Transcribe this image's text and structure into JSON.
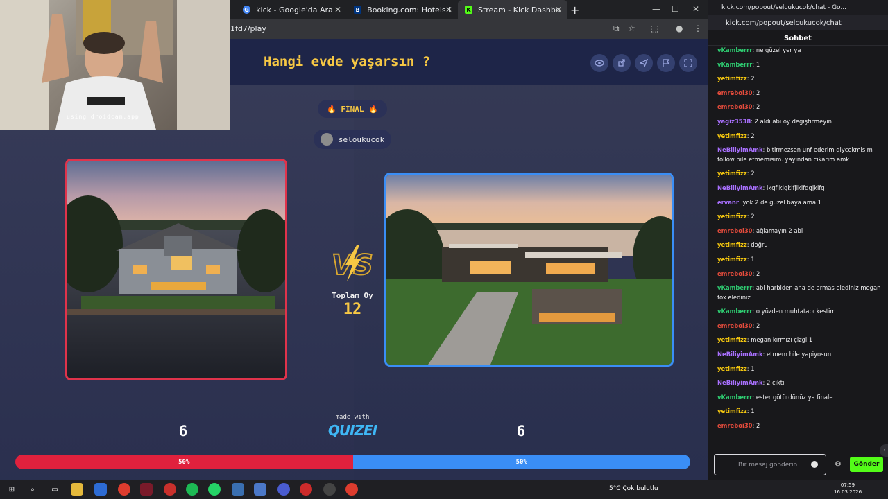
{
  "browser": {
    "tabs": [
      {
        "title": "kick - Google'da Ara",
        "icon": "google-icon",
        "color": "#4285f4"
      },
      {
        "title": "Booking.com: Hotels in Kahire.",
        "icon": "booking-icon",
        "color": "#003580"
      },
      {
        "title": "Stream - Kick Dashboard",
        "icon": "kick-icon",
        "color": "#53fc18"
      }
    ],
    "new_tab": "+",
    "url": "1fd7/play"
  },
  "quiz": {
    "title": "Hangi evde yaşarsın ?",
    "badge": "🔥 FİNAL 🔥",
    "host": "seloukucok",
    "total_label": "Toplam Oy",
    "total_votes": "12",
    "left_votes": "6",
    "right_votes": "6",
    "left_pct": "50%",
    "right_pct": "50%",
    "left_share": 0.5,
    "made_with": "made with",
    "brand": "QUIZEI",
    "colors": {
      "left": "#e0213d",
      "right": "#3a8ef6",
      "accent": "#f6c744"
    },
    "tools": [
      "eye-icon",
      "share-icon",
      "send-icon",
      "flag-icon",
      "fullscreen-icon"
    ]
  },
  "webcam": {
    "caption": "using droidcam.app"
  },
  "chat": {
    "window_title": "kick.com/popout/selcukucok/chat - Go...",
    "url": "kick.com/popout/selcukucok/chat",
    "header": "Sohbet",
    "messages": [
      {
        "user": "vKamberrr",
        "text": "ne güzel yer ya",
        "color": "#2ecc71"
      },
      {
        "user": "vKamberrr",
        "text": "1",
        "color": "#2ecc71"
      },
      {
        "user": "yetimfizz",
        "text": "2",
        "color": "#f1c40f"
      },
      {
        "user": "emreboi30",
        "text": "2",
        "color": "#e74c3c"
      },
      {
        "user": "emreboi30",
        "text": "2",
        "color": "#e74c3c"
      },
      {
        "user": "yagiz3538",
        "text": "2 aldı abi oy değiştirmeyin",
        "color": "#a970ff"
      },
      {
        "user": "yetimfizz",
        "text": "2",
        "color": "#f1c40f"
      },
      {
        "user": "NeBiliyimAmk",
        "text": "bitirmezsen unf ederim diycekmisim follow bile etmemisim. yayindan cikarim amk",
        "color": "#a970ff"
      },
      {
        "user": "yetimfizz",
        "text": "2",
        "color": "#f1c40f"
      },
      {
        "user": "NeBiliyimAmk",
        "text": "lkgfjklgklfjlklfdgjklfg",
        "color": "#a970ff"
      },
      {
        "user": "ervanr",
        "text": "yok 2 de guzel baya ama 1",
        "color": "#a970ff"
      },
      {
        "user": "yetimfizz",
        "text": "2",
        "color": "#f1c40f"
      },
      {
        "user": "emreboi30",
        "text": "ağlamayın 2 abi",
        "color": "#e74c3c"
      },
      {
        "user": "yetimfizz",
        "text": "doğru",
        "color": "#f1c40f"
      },
      {
        "user": "yetimfizz",
        "text": "1",
        "color": "#f1c40f"
      },
      {
        "user": "emreboi30",
        "text": "2",
        "color": "#e74c3c"
      },
      {
        "user": "vKamberrr",
        "text": "abi harbiden ana de armas elediniz megan fox elediniz",
        "color": "#2ecc71"
      },
      {
        "user": "vKamberrr",
        "text": "o yüzden muhtatabı kestim",
        "color": "#2ecc71"
      },
      {
        "user": "emreboi30",
        "text": "2",
        "color": "#e74c3c"
      },
      {
        "user": "yetimfizz",
        "text": "megan kırmızı çizgi 1",
        "color": "#f1c40f"
      },
      {
        "user": "NeBiliyimAmk",
        "text": "etmem hile yapiyosun",
        "color": "#a970ff"
      },
      {
        "user": "yetimfizz",
        "text": "1",
        "color": "#f1c40f"
      },
      {
        "user": "NeBiliyimAmk",
        "text": "2 cikti",
        "color": "#a970ff"
      },
      {
        "user": "vKamberrr",
        "text": "ester götürdünüz ya finale",
        "color": "#2ecc71"
      },
      {
        "user": "yetimfizz",
        "text": "1",
        "color": "#f1c40f"
      },
      {
        "user": "emreboi30",
        "text": "2",
        "color": "#e74c3c"
      }
    ],
    "input_placeholder": "Bir mesaj gönderin",
    "send_label": "Gönder"
  },
  "taskbar": {
    "weather": "5°C Çok bulutlu",
    "time": "07:59",
    "date": "16.03.2026"
  }
}
